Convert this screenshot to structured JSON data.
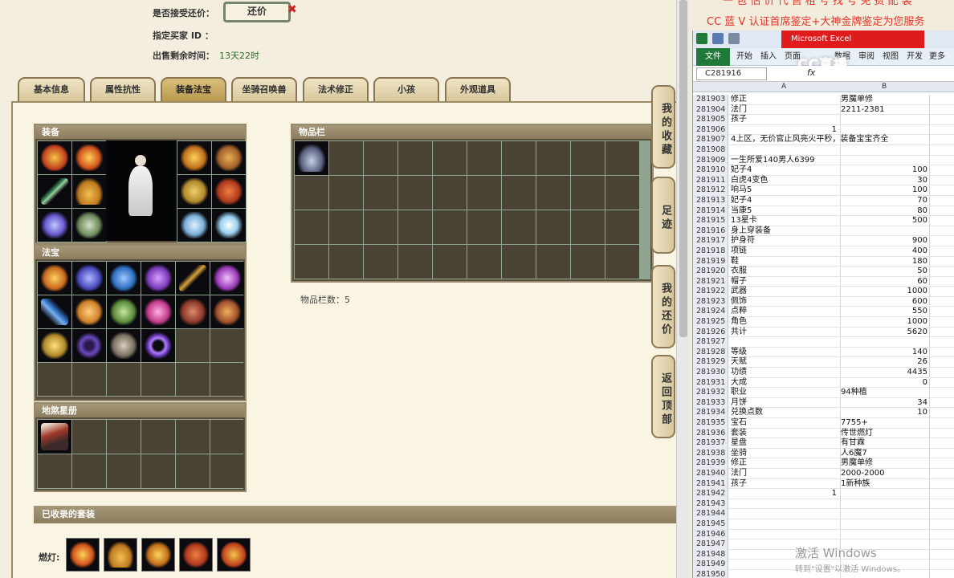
{
  "header": {
    "accept_counter_label": "是否接受还价：",
    "counter_button": "还价",
    "buyer_id_label": "指定买家 ID ：",
    "time_left_label": "出售剩余时间：",
    "time_left_value": "13天22时"
  },
  "tabs": [
    "基本信息",
    "属性抗性",
    "装备法宝",
    "坐骑召唤兽",
    "法术修正",
    "小孩",
    "外观道具"
  ],
  "active_tab": "装备法宝",
  "sections": {
    "equipment_title": "装备",
    "treasure_title": "法宝",
    "star_book_title": "地煞星册",
    "inventory_title": "物品栏",
    "inventory_count_label": "物品栏数：5",
    "suits_title": "已收录的套装",
    "suit_name": "燃灯:"
  },
  "side_tabs": [
    "我的收藏",
    "足迹",
    "我的还价",
    "返回顶部"
  ],
  "ad": {
    "top_text": "一 包 估 价 代 售 租 号 找 号 免 费 配 装",
    "line_text": "CC 蓝 V 认证首席鉴定+大神金牌鉴定为您服务"
  },
  "excel": {
    "title_text": "Microsoft Excel",
    "ribbon": [
      "文件",
      "开始",
      "插入",
      "页面",
      "数据",
      "审阅",
      "视图",
      "开发",
      "更多"
    ],
    "name_box": "C281916",
    "fx": "fx",
    "col_a": "A",
    "col_b": "B",
    "logo": "CC直播",
    "rows": [
      {
        "n": "281903",
        "a": "修正",
        "b": "男魔单修"
      },
      {
        "n": "281904",
        "a": "法门",
        "b": "2211-2381"
      },
      {
        "n": "281905",
        "a": "孩子",
        "b": ""
      },
      {
        "n": "281906",
        "a": "1",
        "b": "",
        "a_num": true
      },
      {
        "n": "281907",
        "a": "4上区，无价官止风亮火平秒，装备宝宝齐全",
        "b": ""
      },
      {
        "n": "281908",
        "a": "",
        "b": ""
      },
      {
        "n": "281909",
        "a": "一生所爱140男人6399",
        "b": ""
      },
      {
        "n": "281910",
        "a": "妃子4",
        "b": "100",
        "b_num": true
      },
      {
        "n": "281911",
        "a": "白虎4变色",
        "b": "30",
        "b_num": true
      },
      {
        "n": "281912",
        "a": "响马5",
        "b": "100",
        "b_num": true
      },
      {
        "n": "281913",
        "a": "妃子4",
        "b": "70",
        "b_num": true
      },
      {
        "n": "281914",
        "a": "当康5",
        "b": "80",
        "b_num": true
      },
      {
        "n": "281915",
        "a": "13星卡",
        "b": "500",
        "b_num": true
      },
      {
        "n": "281916",
        "a": "身上穿装备",
        "b": ""
      },
      {
        "n": "281917",
        "a": "护身符",
        "b": "900",
        "b_num": true
      },
      {
        "n": "281918",
        "a": "项链",
        "b": "400",
        "b_num": true
      },
      {
        "n": "281919",
        "a": "鞋",
        "b": "180",
        "b_num": true
      },
      {
        "n": "281920",
        "a": "衣服",
        "b": "50",
        "b_num": true
      },
      {
        "n": "281921",
        "a": "帽子",
        "b": "60",
        "b_num": true
      },
      {
        "n": "281922",
        "a": "武器",
        "b": "1000",
        "b_num": true
      },
      {
        "n": "281923",
        "a": "佩饰",
        "b": "600",
        "b_num": true
      },
      {
        "n": "281924",
        "a": "点粹",
        "b": "550",
        "b_num": true
      },
      {
        "n": "281925",
        "a": "角色",
        "b": "1000",
        "b_num": true
      },
      {
        "n": "281926",
        "a": "共计",
        "b": "5620",
        "b_num": true
      },
      {
        "n": "281927",
        "a": "",
        "b": ""
      },
      {
        "n": "281928",
        "a": "等级",
        "b": "140",
        "b_num": true
      },
      {
        "n": "281929",
        "a": "天赋",
        "b": "26",
        "b_num": true
      },
      {
        "n": "281930",
        "a": "功绩",
        "b": "4435",
        "b_num": true
      },
      {
        "n": "281931",
        "a": "大成",
        "b": "0",
        "b_num": true
      },
      {
        "n": "281932",
        "a": "职业",
        "b": "94种植"
      },
      {
        "n": "281933",
        "a": "月饼",
        "b": "34",
        "b_num": true
      },
      {
        "n": "281934",
        "a": "兑换点数",
        "b": "10",
        "b_num": true
      },
      {
        "n": "281935",
        "a": "宝石",
        "b": "7755+"
      },
      {
        "n": "281936",
        "a": "套装",
        "b": "传世燃灯"
      },
      {
        "n": "281937",
        "a": "星盘",
        "b": "有甘霖"
      },
      {
        "n": "281938",
        "a": "坐骑",
        "b": "人6魔7"
      },
      {
        "n": "281939",
        "a": "修正",
        "b": "男魔单修"
      },
      {
        "n": "281940",
        "a": "法门",
        "b": "2000-2000"
      },
      {
        "n": "281941",
        "a": "孩子",
        "b": "1新种族"
      },
      {
        "n": "281942",
        "a": "1",
        "b": "",
        "a_num": true
      },
      {
        "n": "281943",
        "a": "",
        "b": ""
      },
      {
        "n": "281944",
        "a": "",
        "b": ""
      },
      {
        "n": "281945",
        "a": "",
        "b": ""
      },
      {
        "n": "281946",
        "a": "",
        "b": ""
      },
      {
        "n": "281947",
        "a": "",
        "b": ""
      },
      {
        "n": "281948",
        "a": "",
        "b": ""
      },
      {
        "n": "281949",
        "a": "",
        "b": ""
      },
      {
        "n": "281950",
        "a": "",
        "b": ""
      }
    ]
  },
  "watermark": {
    "line1": "激活 Windows",
    "line2": "转到\"设置\"以激活 Windows。"
  },
  "colors": {
    "icon_palette": [
      "#c76a1e",
      "#d9a33a",
      "#3a8a5a",
      "#6a5ad0",
      "#c0402c",
      "#2e6fc0",
      "#9a3ab8",
      "#8a6a3a",
      "#d0d0e0",
      "#b08a2a"
    ]
  }
}
